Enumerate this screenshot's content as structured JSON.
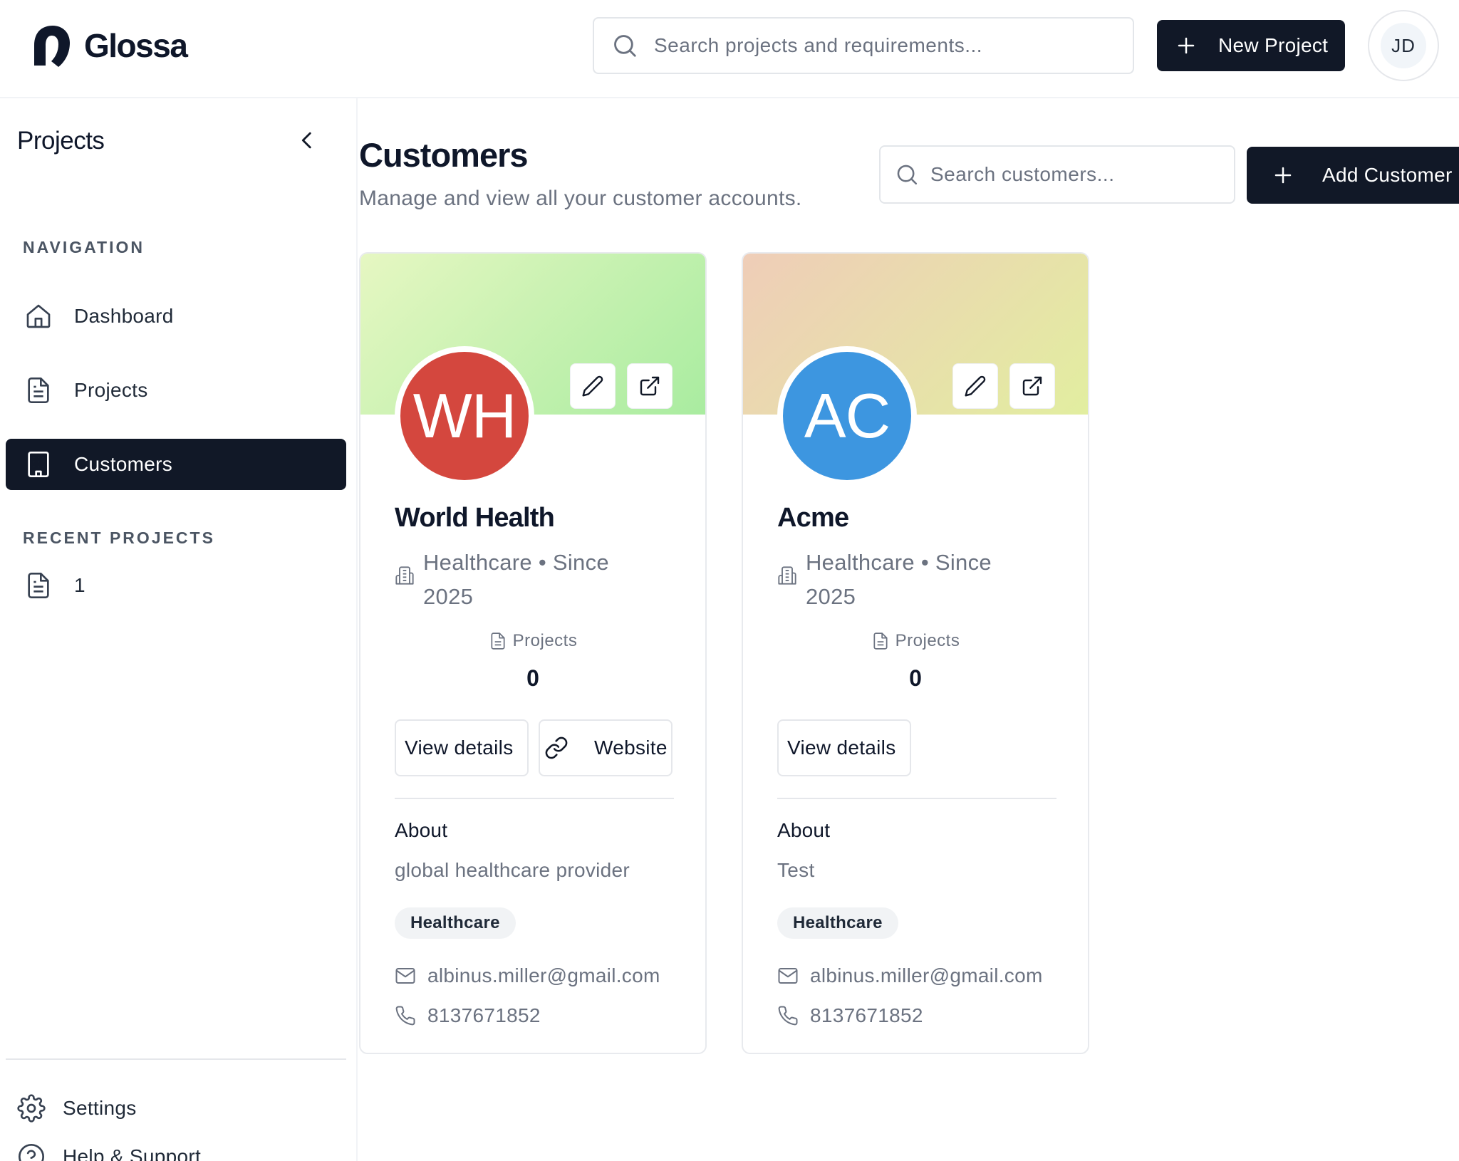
{
  "app": {
    "name": "Glossa",
    "search_placeholder": "Search projects and requirements...",
    "new_project_label": "New Project",
    "user_initials": "JD"
  },
  "sidebar": {
    "title": "Projects",
    "navigation_heading": "NAVIGATION",
    "nav": [
      {
        "label": "Dashboard",
        "icon": "home-icon",
        "active": false
      },
      {
        "label": "Projects",
        "icon": "file-text-icon",
        "active": false
      },
      {
        "label": "Customers",
        "icon": "building-icon",
        "active": true
      }
    ],
    "recent_heading": "RECENT PROJECTS",
    "recent": [
      {
        "label": "1",
        "icon": "file-text-icon"
      }
    ],
    "footer": [
      {
        "label": "Settings",
        "icon": "gear-icon"
      },
      {
        "label": "Help & Support",
        "icon": "help-circle-icon"
      }
    ]
  },
  "main": {
    "title": "Customers",
    "subtitle": "Manage and view all your customer accounts.",
    "search_placeholder": "Search customers...",
    "add_customer_label": "Add Customer"
  },
  "customers": [
    {
      "initials": "WH",
      "name": "World Health",
      "meta": "Healthcare • Since 2025",
      "projects_label": "Projects",
      "projects_count": "0",
      "view_details_label": "View details",
      "website_label": "Website",
      "about_heading": "About",
      "about": "global healthcare provider",
      "tag": "Healthcare",
      "email": "albinus.miller@gmail.com",
      "phone": "8137671852",
      "avatar_color": "#d4473e",
      "banner_colors": [
        "#e6f7c2",
        "#a9eca0"
      ]
    },
    {
      "initials": "AC",
      "name": "Acme",
      "meta": "Healthcare • Since 2025",
      "projects_label": "Projects",
      "projects_count": "0",
      "view_details_label": "View details",
      "about_heading": "About",
      "about": "Test",
      "tag": "Healthcare",
      "email": "albinus.miller@gmail.com",
      "phone": "8137671852",
      "avatar_color": "#3d96e0",
      "banner_colors": [
        "#efcdb8",
        "#e2eea0"
      ]
    }
  ],
  "colors": {
    "primary_dark": "#111827",
    "muted_text": "#6b7280",
    "border": "#e5e7eb"
  }
}
